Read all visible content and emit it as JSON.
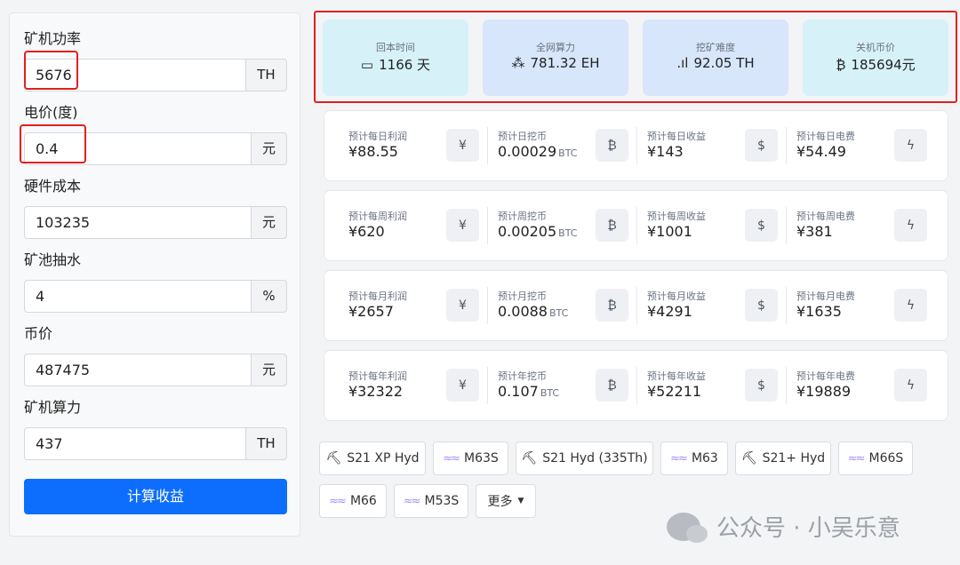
{
  "form": {
    "fields": [
      {
        "label": "矿机功率",
        "value": "5676",
        "suffix": "TH"
      },
      {
        "label": "电价(度)",
        "value": "0.4",
        "suffix": "元"
      },
      {
        "label": "硬件成本",
        "value": "103235",
        "suffix": "元"
      },
      {
        "label": "矿池抽水",
        "value": "4",
        "suffix": "%"
      },
      {
        "label": "币价",
        "value": "487475",
        "suffix": "元"
      },
      {
        "label": "矿机算力",
        "value": "437",
        "suffix": "TH"
      }
    ],
    "calc_button": "计算收益"
  },
  "stats": [
    {
      "title": "回本时间",
      "value": "1166 天",
      "icon": "calendar-icon",
      "icon_glyph": "▭",
      "bg": "#d6f2f8"
    },
    {
      "title": "全网算力",
      "value": "781.32 EH",
      "icon": "network-icon",
      "icon_glyph": "⁂",
      "bg": "#d7e6fb"
    },
    {
      "title": "挖矿难度",
      "value": "92.05 TH",
      "icon": "bar-chart-icon",
      "icon_glyph": ".ıl",
      "bg": "#d7e6fb"
    },
    {
      "title": "关机币价",
      "value": "185694元",
      "icon": "bitcoin-icon",
      "icon_glyph": "₿",
      "bg": "#d6f2f8"
    }
  ],
  "rows": [
    {
      "cells": [
        {
          "title": "预计每日利润",
          "value": "¥88.55",
          "unit": "",
          "icon": "yen-exchange-icon",
          "glyph": "¥"
        },
        {
          "title": "预计日挖币",
          "value": "0.00029",
          "unit": "BTC",
          "icon": "bitcoin-icon",
          "glyph": "₿"
        },
        {
          "title": "预计每日收益",
          "value": "¥143",
          "unit": "",
          "icon": "dollar-circle-icon",
          "glyph": "$"
        },
        {
          "title": "预计每日电费",
          "value": "¥54.49",
          "unit": "",
          "icon": "lightning-icon",
          "glyph": "ϟ"
        }
      ]
    },
    {
      "cells": [
        {
          "title": "预计每周利润",
          "value": "¥620",
          "unit": "",
          "icon": "yen-exchange-icon",
          "glyph": "¥"
        },
        {
          "title": "预计周挖币",
          "value": "0.00205",
          "unit": "BTC",
          "icon": "bitcoin-icon",
          "glyph": "₿"
        },
        {
          "title": "预计每周收益",
          "value": "¥1001",
          "unit": "",
          "icon": "dollar-circle-icon",
          "glyph": "$"
        },
        {
          "title": "预计每周电费",
          "value": "¥381",
          "unit": "",
          "icon": "lightning-icon",
          "glyph": "ϟ"
        }
      ]
    },
    {
      "cells": [
        {
          "title": "预计每月利润",
          "value": "¥2657",
          "unit": "",
          "icon": "yen-exchange-icon",
          "glyph": "¥"
        },
        {
          "title": "预计月挖币",
          "value": "0.0088",
          "unit": "BTC",
          "icon": "bitcoin-icon",
          "glyph": "₿"
        },
        {
          "title": "预计每月收益",
          "value": "¥4291",
          "unit": "",
          "icon": "dollar-circle-icon",
          "glyph": "$"
        },
        {
          "title": "预计每月电费",
          "value": "¥1635",
          "unit": "",
          "icon": "lightning-icon",
          "glyph": "ϟ"
        }
      ]
    },
    {
      "cells": [
        {
          "title": "预计每年利润",
          "value": "¥32322",
          "unit": "",
          "icon": "yen-exchange-icon",
          "glyph": "¥"
        },
        {
          "title": "预计年挖币",
          "value": "0.107",
          "unit": "BTC",
          "icon": "bitcoin-icon",
          "glyph": "₿"
        },
        {
          "title": "预计每年收益",
          "value": "¥52211",
          "unit": "",
          "icon": "dollar-circle-icon",
          "glyph": "$"
        },
        {
          "title": "预计每年电费",
          "value": "¥19889",
          "unit": "",
          "icon": "lightning-icon",
          "glyph": "ϟ"
        }
      ]
    }
  ],
  "miners": [
    {
      "label": "S21 XP Hyd",
      "icon": "antminer-icon"
    },
    {
      "label": "M63S",
      "icon": "whatsminer-icon"
    },
    {
      "label": "S21 Hyd (335Th)",
      "icon": "antminer-icon"
    },
    {
      "label": "M63",
      "icon": "whatsminer-icon"
    },
    {
      "label": "S21+ Hyd",
      "icon": "antminer-icon"
    },
    {
      "label": "M66S",
      "icon": "whatsminer-icon"
    },
    {
      "label": "M66",
      "icon": "whatsminer-icon"
    },
    {
      "label": "M53S",
      "icon": "whatsminer-icon"
    },
    {
      "label": "更多",
      "icon": "caret-down-icon"
    }
  ],
  "watermark": {
    "text": "公众号 · 小吴乐意"
  }
}
